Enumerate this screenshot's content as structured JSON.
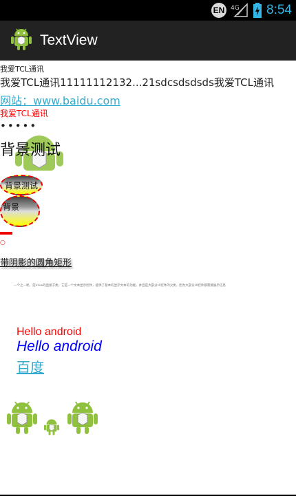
{
  "status_bar": {
    "input_method": "EN",
    "network": "4G",
    "time": "8:54",
    "icons": [
      "signal-icon",
      "battery-charging-icon"
    ]
  },
  "action_bar": {
    "title": "TextView",
    "icon": "android-icon"
  },
  "content": {
    "line1": "我爱TCL通讯",
    "line2": "我爱TCL通讯11111112132...21sdcsdsdsds我爱TCL通讯",
    "website_link": "网站：www.baidu.com",
    "line4_red": "我爱TCL通讯",
    "password_dots": "•••••",
    "background_test_title": "背景测试",
    "bg_button1": "背景测试",
    "bg_button2": "背景",
    "small_circle_text": "○",
    "shadow_rounded_rect": "带阴影的圆角矩形",
    "tiny_marquee": "一个之一呢，是View的直接子类，它是一个文本显示控件，提供了基本的显示文本的功能，并且是大部分UI控件的父类，因为大部分UI控件都需要展示信息",
    "hello_red": "Hello android",
    "hello_blue_italic": "Hello android",
    "baidu": "百度",
    "colors": {
      "accent_blue": "#33b5e5",
      "link": "#33aacc",
      "red": "#ff0000",
      "blue": "#0000ff",
      "android_green": "#8fc13e"
    },
    "images": [
      "android-robot-large",
      "android-robot-small",
      "android-robot-large"
    ]
  }
}
